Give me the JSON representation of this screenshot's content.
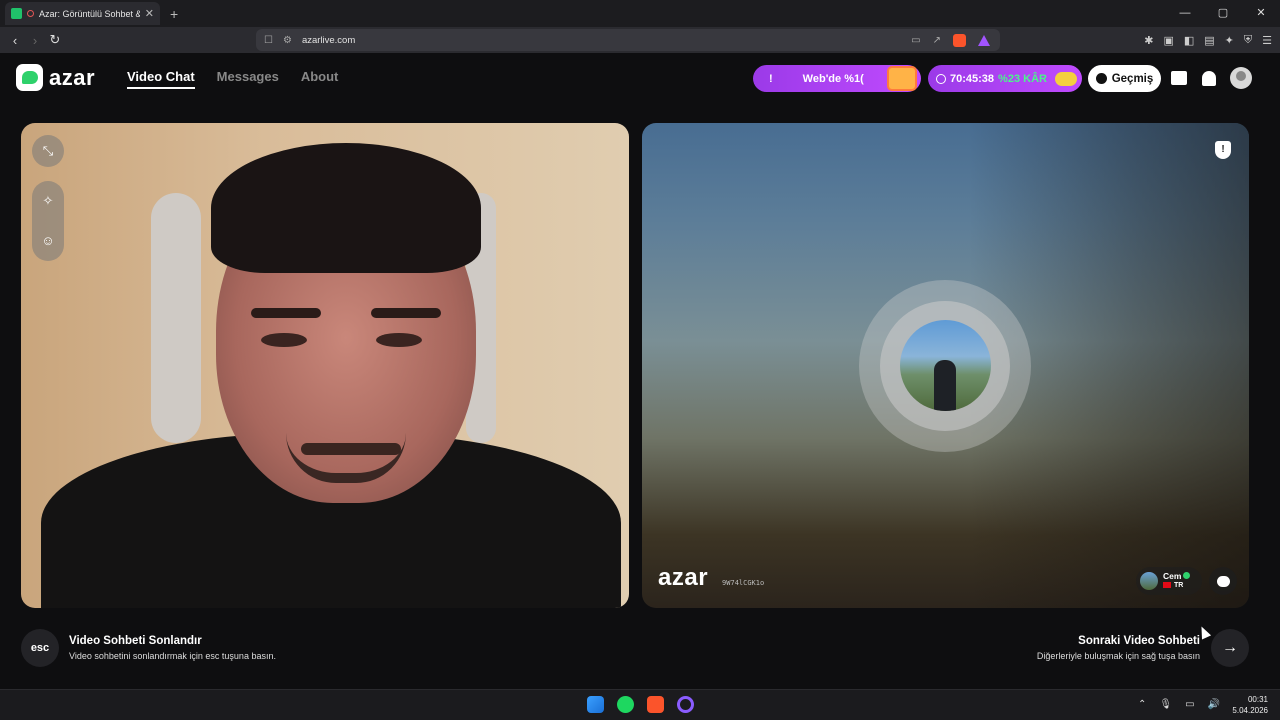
{
  "browser": {
    "tab_title": "Azar: Görüntülü Sohbet & Yeni",
    "tab_close": "✕",
    "new_tab": "+",
    "url": "azarlive.com",
    "window_controls": [
      "—",
      "▢",
      "✕"
    ]
  },
  "header": {
    "logo_text": "azar",
    "nav": [
      "Video Chat",
      "Messages",
      "About"
    ],
    "promo1_left": "!",
    "promo1_text": "Web'de %1(",
    "promo2_timer": "70:45:38",
    "promo2_discount": "%23 KÂR",
    "history_label": "Geçmiş"
  },
  "remote": {
    "watermark": "azar",
    "session_id": "9W74lCGK1o",
    "partner_name": "Cem",
    "partner_country": "TR"
  },
  "bottom": {
    "esc_label": "esc",
    "end_title": "Video Sohbeti Sonlandır",
    "end_sub": "Video sohbetini sonlandırmak için esc tuşuna basın.",
    "next_title": "Sonraki Video Sohbeti",
    "next_sub": "Diğerleriyle buluşmak için sağ tuşa basın",
    "next_arrow": "→"
  },
  "taskbar": {
    "time": "00:31",
    "date": "5.04.2026"
  },
  "colors": {
    "accent_green": "#2ed16b",
    "promo_purple": "#a845f0",
    "background": "#0e0e10"
  }
}
